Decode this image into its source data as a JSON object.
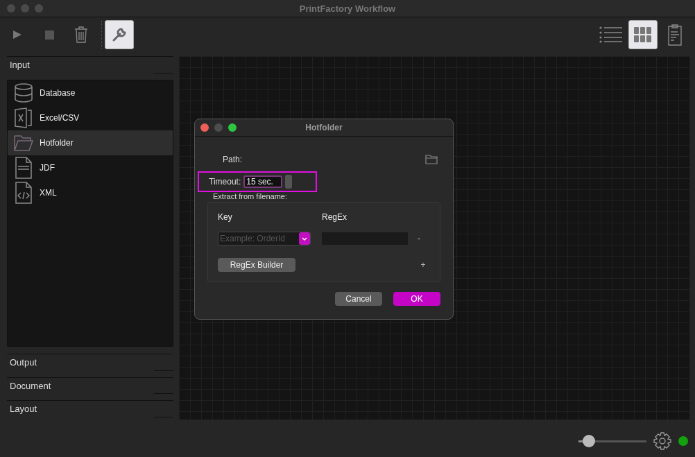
{
  "window": {
    "title": "PrintFactory Workflow"
  },
  "toolbar": {
    "left": [
      {
        "kind": "play",
        "selected": false
      },
      {
        "kind": "stop",
        "selected": false
      },
      {
        "kind": "trash",
        "selected": false
      },
      {
        "kind": "wrench",
        "selected": true
      }
    ],
    "right": [
      {
        "kind": "list",
        "selected": false
      },
      {
        "kind": "grid",
        "selected": true
      },
      {
        "kind": "clipboard",
        "selected": false
      }
    ]
  },
  "sidebar": {
    "sections": [
      {
        "label": "Input",
        "expanded": true,
        "items": [
          {
            "label": "Database",
            "kind": "database",
            "selected": false
          },
          {
            "label": "Excel/CSV",
            "kind": "excel",
            "selected": false
          },
          {
            "label": "Hotfolder",
            "kind": "folder",
            "selected": true
          },
          {
            "label": "JDF",
            "kind": "jdf",
            "selected": false
          },
          {
            "label": "XML",
            "kind": "xml",
            "selected": false
          }
        ]
      },
      {
        "label": "Output",
        "expanded": false
      },
      {
        "label": "Document",
        "expanded": false
      },
      {
        "label": "Layout",
        "expanded": false
      }
    ]
  },
  "dialog": {
    "title": "Hotfolder",
    "path_label": "Path:",
    "timeout": {
      "label": "Timeout:",
      "value": "15 sec.",
      "highlighted": true
    },
    "extract_label": "Extract from filename:",
    "columns": [
      "Key",
      "RegEx"
    ],
    "row": {
      "key_placeholder": "Example: OrderId",
      "remove": "-"
    },
    "builder_button": "RegEx Builder",
    "add": "+",
    "buttons": [
      {
        "label": "Cancel",
        "kind": "secondary"
      },
      {
        "label": "OK",
        "kind": "primary"
      }
    ]
  },
  "status_bar": {
    "zoom": {
      "level": 0.15
    },
    "status": {
      "color": "#13a10e"
    }
  }
}
